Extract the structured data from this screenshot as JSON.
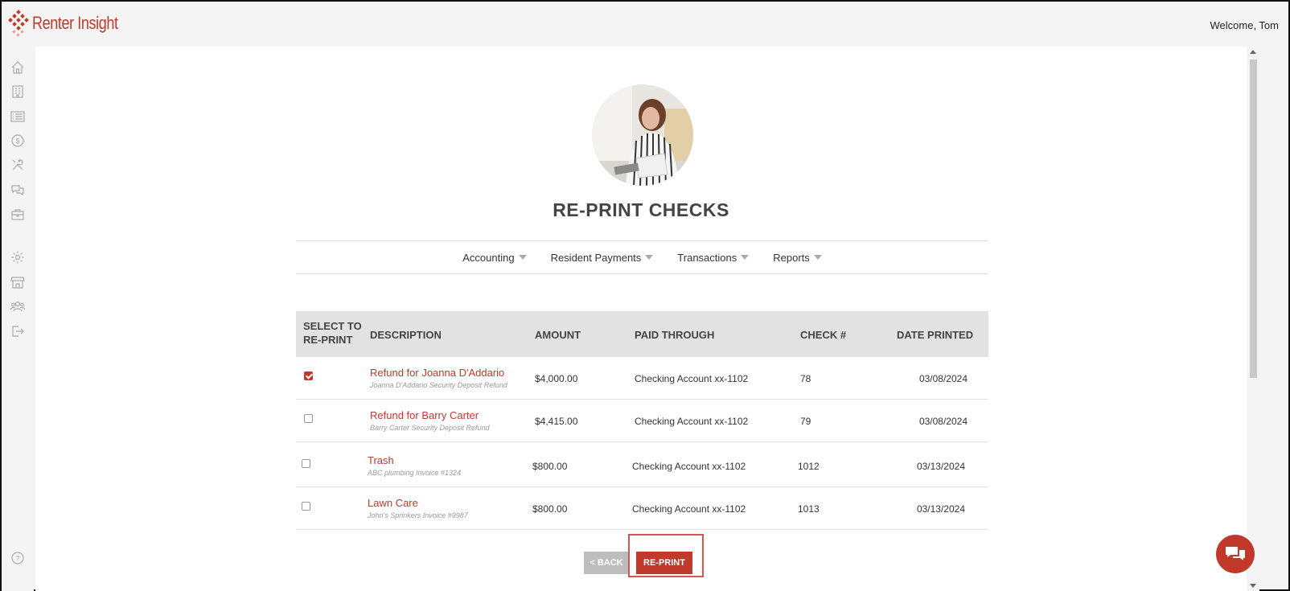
{
  "app": {
    "logo_text": "Renter Insight",
    "welcome": "Welcome, Tom"
  },
  "sidebar": {
    "items": [
      {
        "icon": "home-icon"
      },
      {
        "icon": "building-icon"
      },
      {
        "icon": "list-icon"
      },
      {
        "icon": "dollar-icon"
      },
      {
        "icon": "tools-icon"
      },
      {
        "icon": "chat-icon"
      },
      {
        "icon": "briefcase-icon"
      },
      {
        "icon": "gear-icon"
      },
      {
        "icon": "store-icon"
      },
      {
        "icon": "users-icon"
      },
      {
        "icon": "logout-icon"
      },
      {
        "icon": "help-icon"
      }
    ]
  },
  "page": {
    "title": "RE-PRINT CHECKS"
  },
  "nav": {
    "items": [
      "Accounting",
      "Resident Payments",
      "Transactions",
      "Reports"
    ]
  },
  "table": {
    "headers": {
      "select_line1": "SELECT TO",
      "select_line2": "RE-PRINT",
      "description": "DESCRIPTION",
      "amount": "AMOUNT",
      "paid_through": "PAID THROUGH",
      "check": "CHECK #",
      "date_printed": "DATE PRINTED"
    },
    "rows": [
      {
        "checked": true,
        "title": "Refund for Joanna D'Addario",
        "subtitle": "Joanna D'Addario Security Deposit Refund",
        "amount": "$4,000.00",
        "paid_through": "Checking Account xx-1102",
        "check": "78",
        "date": "03/08/2024"
      },
      {
        "checked": false,
        "title": "Refund for Barry Carter",
        "subtitle": "Barry Carter Security Deposit Refund",
        "amount": "$4,415.00",
        "paid_through": "Checking Account xx-1102",
        "check": "79",
        "date": "03/08/2024"
      },
      {
        "checked": false,
        "title": "Trash",
        "subtitle": "ABC plumbing Invoice #1324",
        "amount": "$800.00",
        "paid_through": "Checking Account xx-1102",
        "check": "1012",
        "date": "03/13/2024"
      },
      {
        "checked": false,
        "title": "Lawn Care",
        "subtitle": "John's Sprinkers Invoice #9987",
        "amount": "$800.00",
        "paid_through": "Checking Account xx-1102",
        "check": "1013",
        "date": "03/13/2024"
      }
    ]
  },
  "buttons": {
    "back": "< BACK",
    "reprint": "RE-PRINT"
  },
  "colors": {
    "accent": "#c0392b",
    "header_bg": "#e2e2e2"
  }
}
